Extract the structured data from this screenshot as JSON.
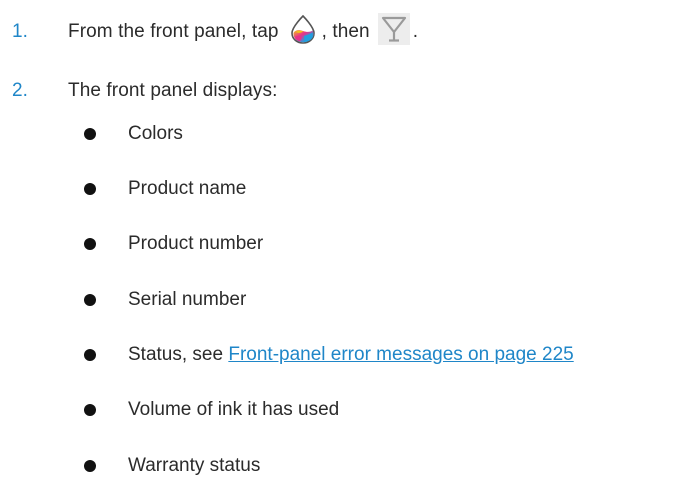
{
  "steps": [
    {
      "number": "1.",
      "text_before_icon1": "From the front panel, tap",
      "text_between_icons": ", then",
      "text_after_icon2": ".",
      "icon1": "ink-drop-icon",
      "icon2": "printhead-icon"
    },
    {
      "number": "2.",
      "text": "The front panel displays:"
    }
  ],
  "bullets": [
    {
      "text": "Colors"
    },
    {
      "text": "Product name"
    },
    {
      "text": "Product number"
    },
    {
      "text": "Serial number"
    },
    {
      "text": "Status, see ",
      "link": "Front-panel error messages on page 225"
    },
    {
      "text": "Volume of ink it has used"
    },
    {
      "text": "Warranty status"
    }
  ],
  "colors": {
    "accent": "#1f86c8",
    "text": "#2b2b2b"
  }
}
